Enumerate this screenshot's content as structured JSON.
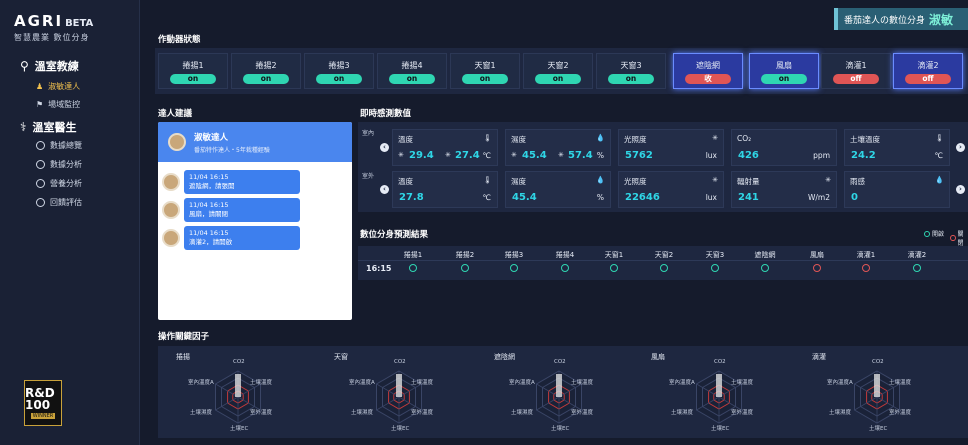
{
  "brand": {
    "logo": "AGRI",
    "beta": "BETA",
    "subtitle": "智慧農業 數位分身"
  },
  "sidebar": {
    "sections": [
      {
        "label": "溫室教練",
        "items": [
          "淑敏達人",
          "場域監控"
        ]
      },
      {
        "label": "溫室醫生",
        "items": [
          "數據總覽",
          "數據分析",
          "營養分析",
          "回饋評估"
        ]
      }
    ],
    "award": {
      "main": "R&D 100",
      "sub": "WINNER"
    }
  },
  "header_badge": {
    "prefix": "番茄達人の數位分身",
    "name": "淑敏"
  },
  "actuator_title": "作動器狀態",
  "actuators": [
    {
      "label": "捲揚1",
      "state": "on"
    },
    {
      "label": "捲揚2",
      "state": "on"
    },
    {
      "label": "捲揚3",
      "state": "on"
    },
    {
      "label": "捲揚4",
      "state": "on"
    },
    {
      "label": "天窗1",
      "state": "on"
    },
    {
      "label": "天窗2",
      "state": "on"
    },
    {
      "label": "天窗3",
      "state": "on"
    },
    {
      "label": "遮陰網",
      "state": "收"
    },
    {
      "label": "風扇",
      "state": "on"
    },
    {
      "label": "滴灌1",
      "state": "off"
    },
    {
      "label": "滴灌2",
      "state": "off"
    }
  ],
  "expert_title": "達人建議",
  "expert": {
    "name": "淑敏達人",
    "desc": "番茄特作達人・5年栽種經驗"
  },
  "messages": [
    {
      "time": "11/04 16:15",
      "text": "遮陰網，請張開"
    },
    {
      "time": "11/04 16:15",
      "text": "風扇，請關閉"
    },
    {
      "time": "11/04 16:15",
      "text": "滴灌2，請開啟"
    }
  ],
  "sensor_title": "即時感測數值",
  "sensor_rows": {
    "indoor": "室內",
    "outdoor": "室外"
  },
  "sensors_indoor": [
    {
      "label": "溫度",
      "v1": "29.4",
      "v2": "27.4",
      "unit": "℃"
    },
    {
      "label": "濕度",
      "v1": "45.4",
      "v2": "57.4",
      "unit": "%"
    },
    {
      "label": "光照度",
      "v1": "5762",
      "unit": "lux"
    },
    {
      "label": "CO₂",
      "v1": "426",
      "unit": "ppm"
    },
    {
      "label": "土壤溫度",
      "v1": "24.2",
      "unit": "℃"
    }
  ],
  "sensors_outdoor": [
    {
      "label": "溫度",
      "v1": "27.8",
      "unit": "℃"
    },
    {
      "label": "濕度",
      "v1": "45.4",
      "unit": "%"
    },
    {
      "label": "光照度",
      "v1": "22646",
      "unit": "lux"
    },
    {
      "label": "輻射量",
      "v1": "241",
      "unit": "W/m2"
    },
    {
      "label": "雨感",
      "v1": "0",
      "unit": ""
    }
  ],
  "prediction_title": "數位分身預測結果",
  "prediction_legend": [
    {
      "label": "開啟"
    },
    {
      "label": "關閉"
    }
  ],
  "prediction_headers": [
    "捲揚1",
    "捲揚2",
    "捲揚3",
    "捲揚4",
    "天窗1",
    "天窗2",
    "天窗3",
    "遮陰網",
    "風扇",
    "滴灌1",
    "滴灌2"
  ],
  "prediction_time": "16:15",
  "prediction_states": [
    "on",
    "on",
    "on",
    "on",
    "on",
    "on",
    "on",
    "on",
    "off",
    "off",
    "on"
  ],
  "factor_title": "操作關鍵因子",
  "factors": [
    {
      "name": "捲揚"
    },
    {
      "name": "天窗"
    },
    {
      "name": "遮陰網"
    },
    {
      "name": "風扇"
    },
    {
      "name": "滴灌"
    }
  ],
  "radar_axes": {
    "top": "CO2",
    "upper_left": "室內溫度A",
    "upper_right": "土壤溫度",
    "lower_left": "土壤濕度",
    "lower_right": "室外溫度",
    "bottom": "土壤EC"
  },
  "colors": {
    "accent": "#2fd6b2",
    "off": "#e05555",
    "highlight": "#2b3aa0",
    "expert_blue": "#4a86ee"
  }
}
